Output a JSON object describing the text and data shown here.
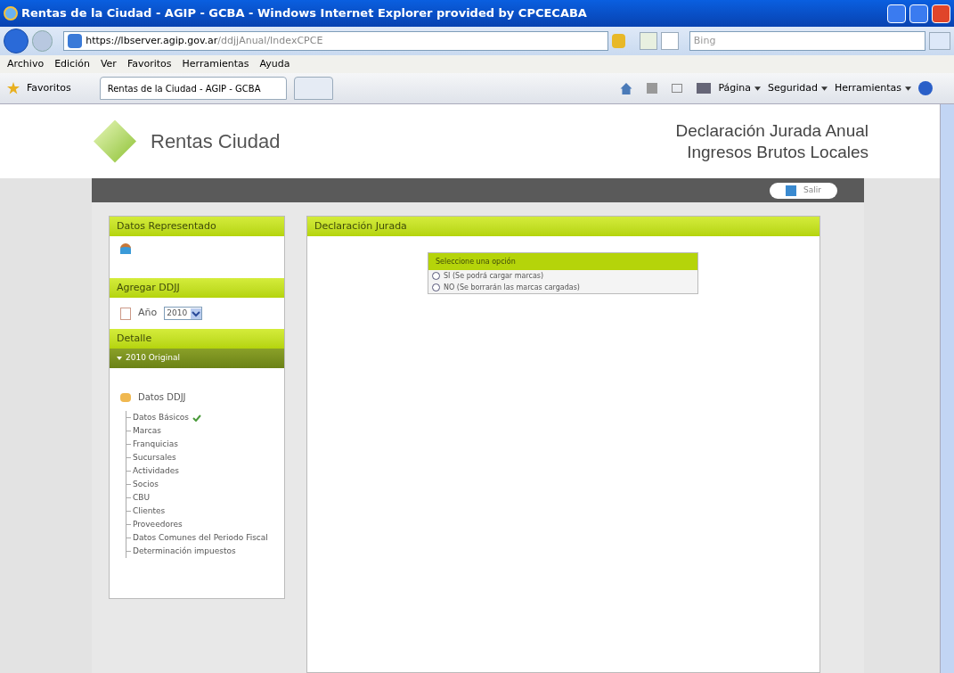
{
  "window": {
    "title": "Rentas de la Ciudad - AGIP - GCBA - Windows Internet Explorer provided by CPCECABA"
  },
  "address_bar": {
    "url_host": "https://lbserver.agip.gov.ar",
    "url_path": "/ddjjAnual/IndexCPCE",
    "search_placeholder": "Bing"
  },
  "menu": [
    "Archivo",
    "Edición",
    "Ver",
    "Favoritos",
    "Herramientas",
    "Ayuda"
  ],
  "favorites_bar": {
    "favorites": "Favoritos",
    "tabs": [
      {
        "label": "Rentas de la Ciudad - AGIP - GCBA",
        "selected": true
      }
    ],
    "commands": [
      "Página",
      "Seguridad",
      "Herramientas"
    ]
  },
  "header": {
    "brand": "Rentas Ciudad",
    "title_line_1": "Declaración Jurada Anual",
    "title_line_2": "Ingresos Brutos Locales",
    "logout": "Salir"
  },
  "sidebar": {
    "represented_title": "Datos Representado",
    "add_title": "Agregar DDJJ",
    "year_label": "Año",
    "year_value": "2010",
    "detail_title": "Detalle",
    "detail_item": "2010 Original",
    "folder": "Datos DDJJ",
    "items": [
      {
        "label": "Datos Básicos",
        "done": true
      },
      {
        "label": "Marcas",
        "done": false
      },
      {
        "label": "Franquicias",
        "done": false
      },
      {
        "label": "Sucursales",
        "done": false
      },
      {
        "label": "Actividades",
        "done": false
      },
      {
        "label": "Socios",
        "done": false
      },
      {
        "label": "CBU",
        "done": false
      },
      {
        "label": "Clientes",
        "done": false
      },
      {
        "label": "Proveedores",
        "done": false
      },
      {
        "label": "Datos Comunes del Periodo Fiscal",
        "done": false
      },
      {
        "label": "Determinación impuestos",
        "done": false
      }
    ]
  },
  "main": {
    "title": "Declaración Jurada",
    "option_box": {
      "title": "Seleccione una opción",
      "options": [
        {
          "label": "SI (Se podrá cargar marcas)",
          "selected": false
        },
        {
          "label": "NO (Se borrarán las marcas cargadas)",
          "selected": false
        }
      ]
    }
  }
}
